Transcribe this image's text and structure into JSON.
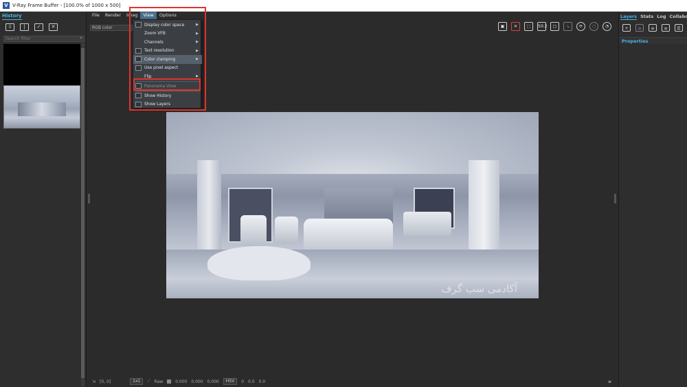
{
  "window": {
    "title": "V-Ray Frame Buffer - [100.0% of 1000 x 500]",
    "app_icon": "V"
  },
  "menubar": {
    "items": [
      "File",
      "Render",
      "Imag",
      "View",
      "Options"
    ],
    "active": "View"
  },
  "history": {
    "tab": "History",
    "search_placeholder": "Search filter",
    "tools": [
      "save-to-history-icon",
      "compare-ab-icon",
      "load-image-icon",
      "clear-history-icon"
    ]
  },
  "channel": {
    "selected": "RGB color"
  },
  "view_menu": {
    "items": [
      {
        "label": "Display color space",
        "submenu": true
      },
      {
        "label": "Zoom VFB",
        "submenu": true
      },
      {
        "label": "Channels",
        "submenu": true
      },
      {
        "label": "Test resolution",
        "submenu": true
      },
      {
        "label": "Color clamping",
        "submenu": true
      },
      {
        "label": "Use pixel aspect",
        "submenu": false
      },
      {
        "label": "Flip",
        "submenu": true
      },
      {
        "label": "Panorama View",
        "submenu": false
      },
      {
        "label": "Show History",
        "submenu": false
      },
      {
        "label": "Show Layers",
        "submenu": false
      }
    ]
  },
  "main_toolbar": {
    "zoom_label": "50:2"
  },
  "render": {
    "watermark": "آکادمی سب گرف"
  },
  "right_panel": {
    "tabs": [
      "Layers",
      "Stats",
      "Log",
      "Collaborat"
    ],
    "active_tab": "Layers",
    "properties_label": "Properties"
  },
  "status": {
    "coords": "[0, 0]",
    "zoom": "1x1",
    "raw_label": "Raw",
    "raw_values": [
      "0.000",
      "0.000",
      "0.000"
    ],
    "color_mode": "HSV",
    "hsv_values": [
      "0",
      "0.0",
      "0.0"
    ]
  },
  "colors": {
    "accent": "#4fb3e8",
    "highlight": "#e0342a",
    "panel_bg": "#2e2e2e"
  }
}
